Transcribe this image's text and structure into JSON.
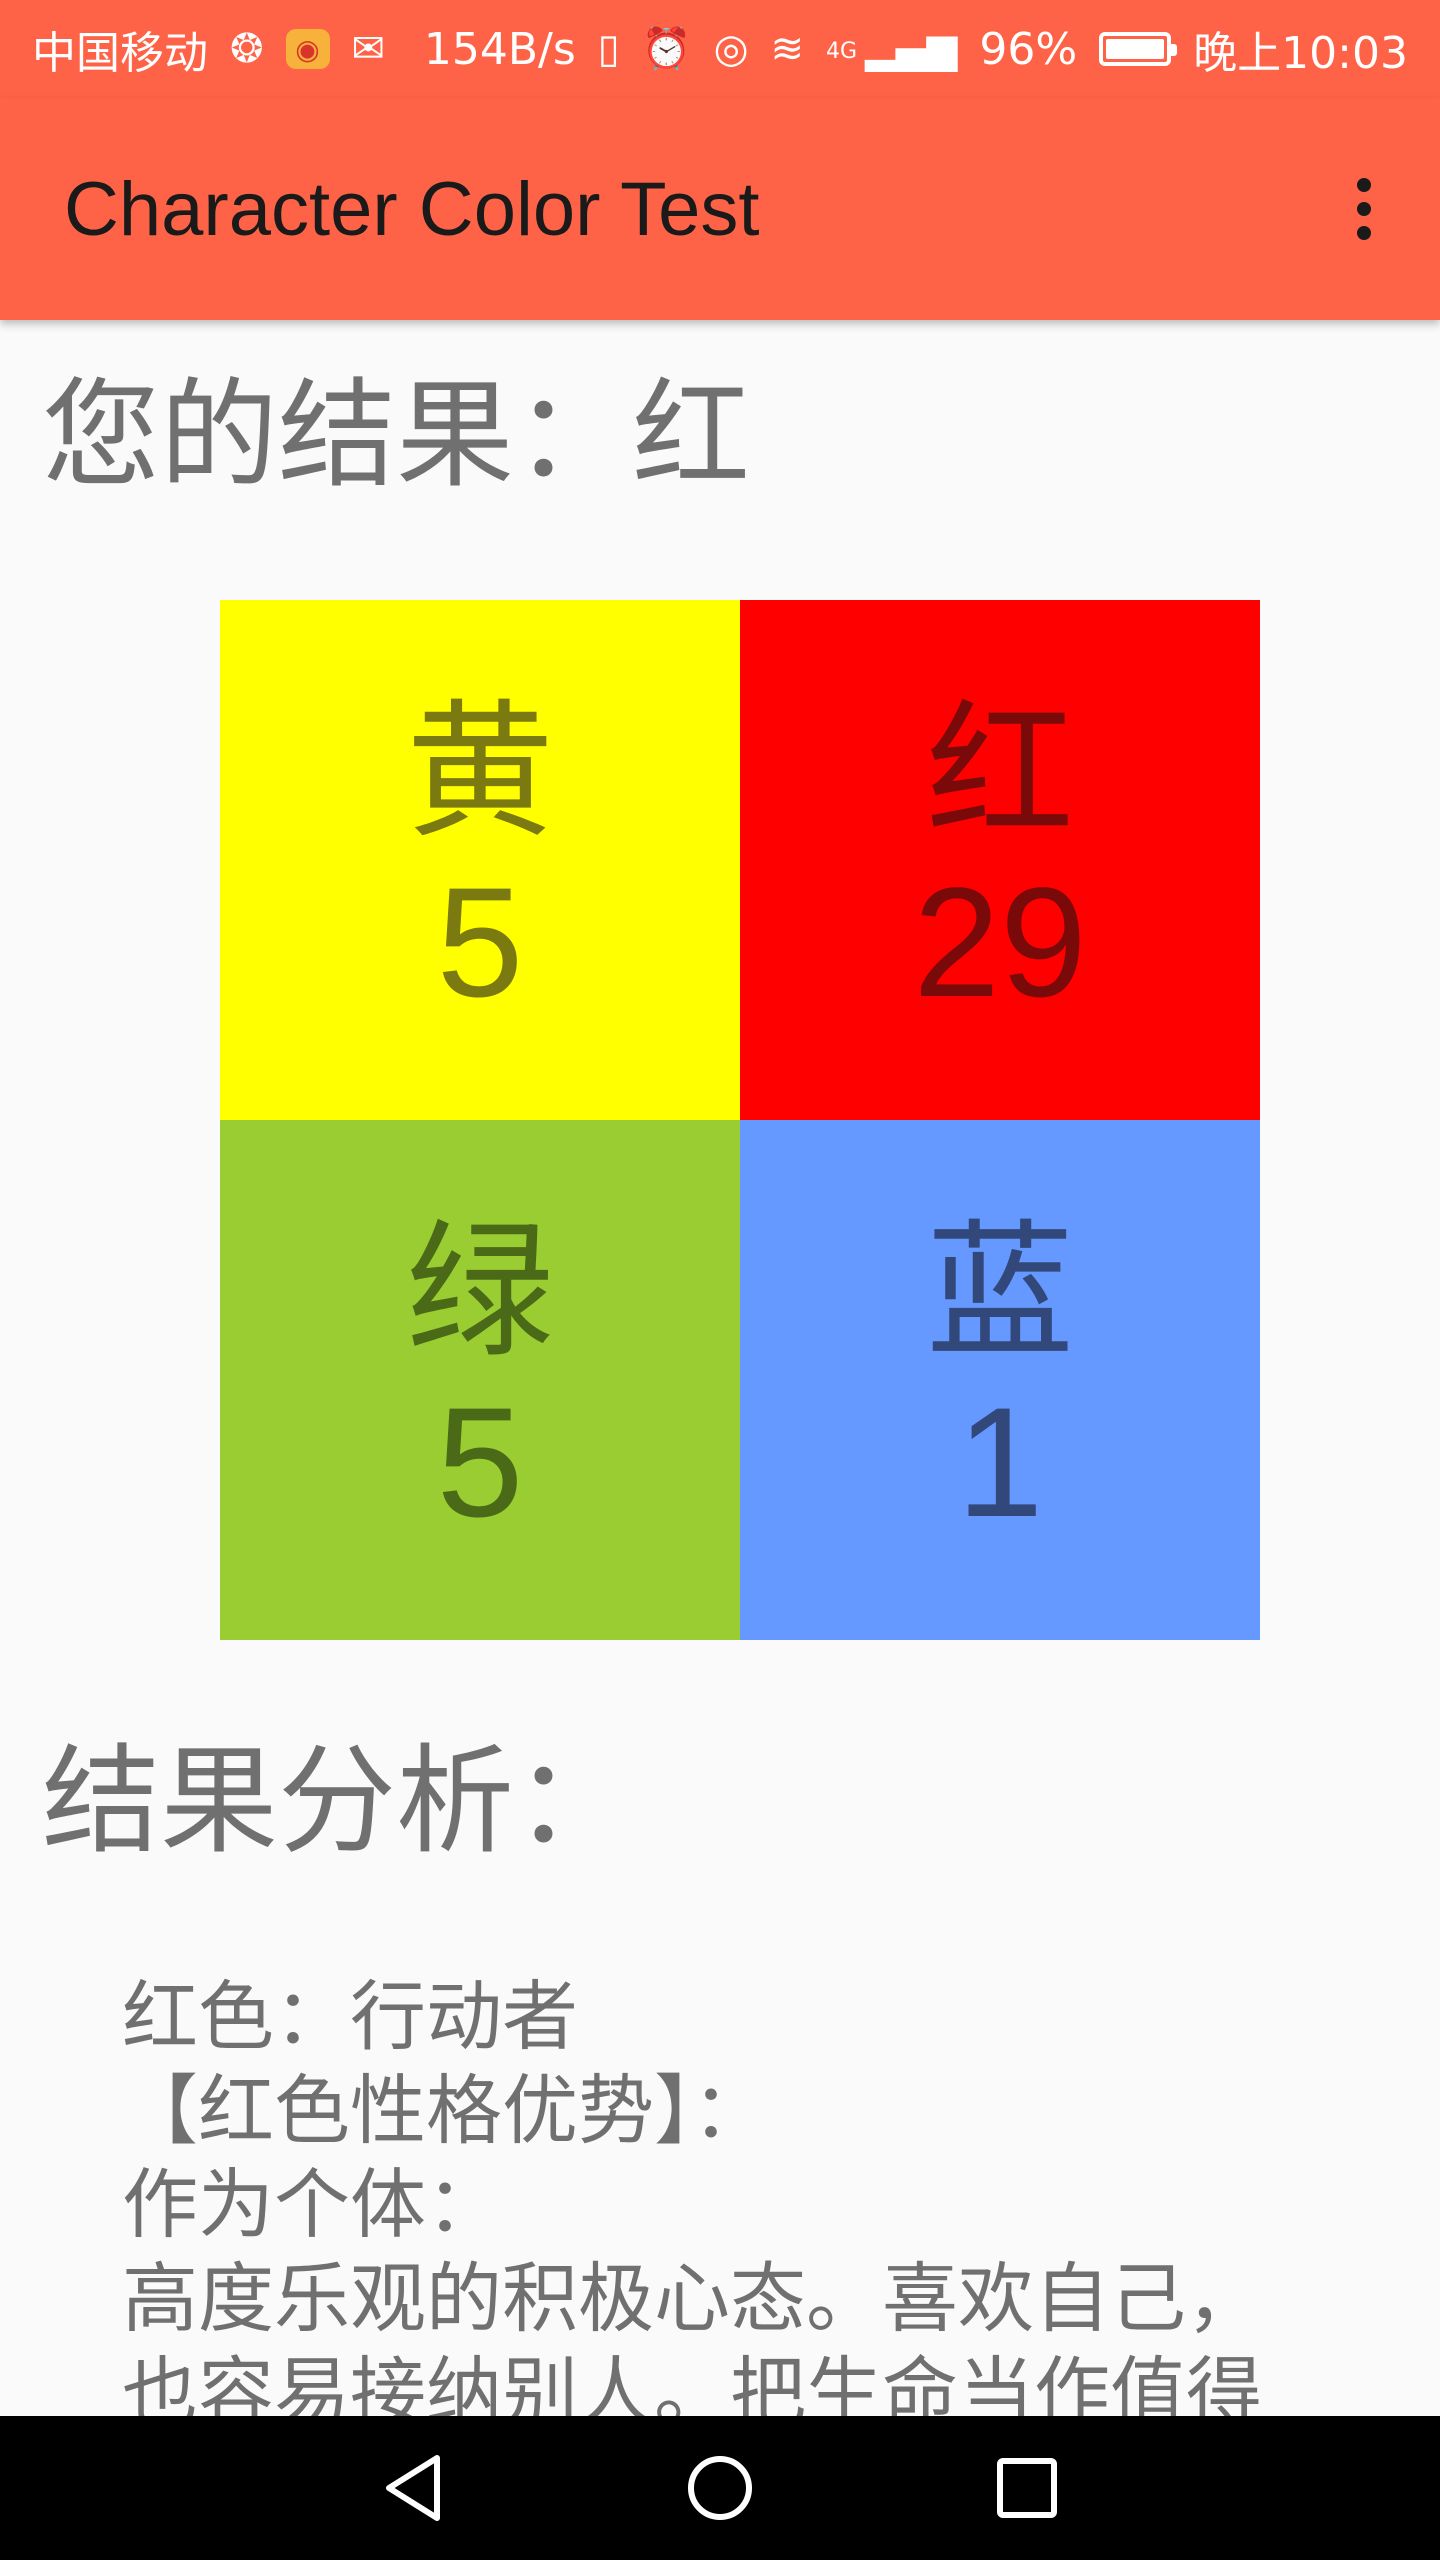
{
  "status_bar": {
    "carrier": "中国移动",
    "net_speed": "154B/s",
    "network": "4G",
    "battery": "96%",
    "time": "晚上10:03"
  },
  "app_bar": {
    "title": "Character Color Test"
  },
  "result": {
    "heading": "您的结果：红"
  },
  "colors": [
    {
      "name": "黄",
      "count": "5",
      "bg": "#ffff00"
    },
    {
      "name": "红",
      "count": "29",
      "bg": "#ff0000"
    },
    {
      "name": "绿",
      "count": "5",
      "bg": "#9acd32"
    },
    {
      "name": "蓝",
      "count": "1",
      "bg": "#6699ff"
    }
  ],
  "analysis": {
    "heading": "结果分析：",
    "lines": [
      "红色：行动者",
      "【红色性格优势】：",
      "作为个体：",
      "高度乐观的积极心态。喜欢自己，",
      "也容易接纳别人。把生命当作值得"
    ]
  },
  "theme": {
    "app_bar_color": "#ff6347"
  }
}
